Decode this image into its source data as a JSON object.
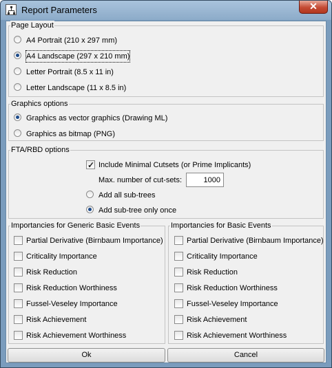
{
  "window": {
    "title": "Report Parameters",
    "close_glyph": "✕"
  },
  "page_layout": {
    "legend": "Page Layout",
    "options": [
      {
        "label": "A4 Portrait (210 x 297 mm)",
        "selected": false
      },
      {
        "label": "A4 Landscape (297 x 210 mm)",
        "selected": true
      },
      {
        "label": "Letter Portrait (8.5 x 11 in)",
        "selected": false
      },
      {
        "label": "Letter Landscape (11 x 8.5 in)",
        "selected": false
      }
    ]
  },
  "graphics": {
    "legend": "Graphics options",
    "options": [
      {
        "label": "Graphics as vector graphics (Drawing ML)",
        "selected": true
      },
      {
        "label": "Graphics as bitmap (PNG)",
        "selected": false
      }
    ]
  },
  "fta": {
    "legend": "FTA/RBD options",
    "include_cutsets_label": "Include Minimal Cutsets (or Prime Implicants)",
    "include_cutsets_checked": true,
    "max_cutsets_label": "Max. number of cut-sets:",
    "max_cutsets_value": "1000",
    "subtree_options": [
      {
        "label": "Add all sub-trees",
        "selected": false
      },
      {
        "label": "Add sub-tree only once",
        "selected": true
      }
    ]
  },
  "generic_importances": {
    "legend": "Importancies for Generic Basic Events",
    "items": [
      {
        "label": "Partial Derivative (Birnbaum Importance)",
        "checked": false
      },
      {
        "label": "Criticality Importance",
        "checked": false
      },
      {
        "label": "Risk Reduction",
        "checked": false
      },
      {
        "label": "Risk Reduction Worthiness",
        "checked": false
      },
      {
        "label": "Fussel-Veseley Importance",
        "checked": false
      },
      {
        "label": "Risk Achievement",
        "checked": false
      },
      {
        "label": "Risk Achievement Worthiness",
        "checked": false
      }
    ]
  },
  "basic_importances": {
    "legend": "Importancies for Basic Events",
    "items": [
      {
        "label": "Partial Derivative (Birnbaum Importance)",
        "checked": false
      },
      {
        "label": "Criticality Importance",
        "checked": false
      },
      {
        "label": "Risk Reduction",
        "checked": false
      },
      {
        "label": "Risk Reduction Worthiness",
        "checked": false
      },
      {
        "label": "Fussel-Veseley Importance",
        "checked": false
      },
      {
        "label": "Risk Achievement",
        "checked": false
      },
      {
        "label": "Risk Achievement Worthiness",
        "checked": false
      }
    ]
  },
  "buttons": {
    "ok": "Ok",
    "cancel": "Cancel"
  }
}
